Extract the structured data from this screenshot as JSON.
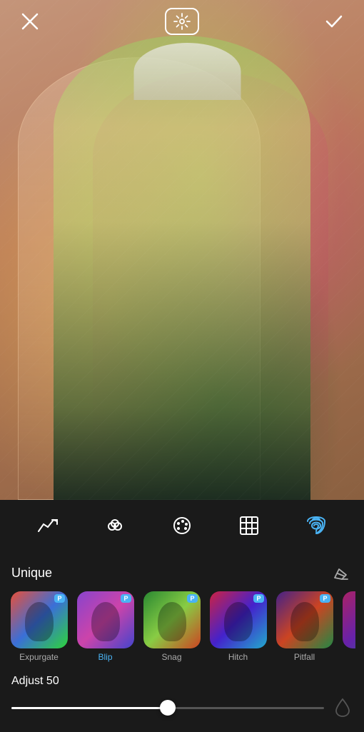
{
  "header": {
    "close_label": "×",
    "settings_label": "settings",
    "confirm_label": "✓"
  },
  "toolbar": {
    "tools": [
      {
        "id": "curve",
        "label": "curve",
        "active": false
      },
      {
        "id": "effects",
        "label": "effects",
        "active": false
      },
      {
        "id": "palette",
        "label": "palette",
        "active": false
      },
      {
        "id": "overlay",
        "label": "overlay",
        "active": false
      },
      {
        "id": "fingerprint",
        "label": "fingerprint",
        "active": true
      }
    ]
  },
  "filters_section": {
    "title": "Unique",
    "filters": [
      {
        "id": "expurgate",
        "name": "Expurgate",
        "active": false,
        "pro": true
      },
      {
        "id": "blip",
        "name": "Blip",
        "active": true,
        "pro": true
      },
      {
        "id": "snag",
        "name": "Snag",
        "active": false,
        "pro": true
      },
      {
        "id": "hitch",
        "name": "Hitch",
        "active": false,
        "pro": true
      },
      {
        "id": "pitfall",
        "name": "Pitfall",
        "active": false,
        "pro": true
      },
      {
        "id": "extra",
        "name": "...",
        "active": false,
        "pro": true
      }
    ]
  },
  "adjust": {
    "label": "Adjust 50",
    "value": 50,
    "min": 0,
    "max": 100
  },
  "colors": {
    "active_blue": "#4ab3f4",
    "bg_dark": "#1a1a1a",
    "text_white": "#ffffff",
    "text_gray": "#aaaaaa"
  }
}
